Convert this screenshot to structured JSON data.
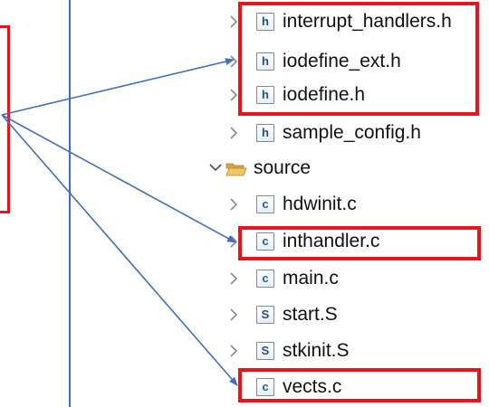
{
  "tree": {
    "items": [
      {
        "name": "interrupt_handlers.h",
        "type": "header",
        "badge": "h"
      },
      {
        "name": "iodefine_ext.h",
        "type": "header",
        "badge": "h"
      },
      {
        "name": "iodefine.h",
        "type": "header",
        "badge": "h"
      },
      {
        "name": "sample_config.h",
        "type": "header",
        "badge": "h"
      },
      {
        "name": "source",
        "type": "folder",
        "expanded": true
      },
      {
        "name": "hdwinit.c",
        "type": "c-source",
        "badge": "c"
      },
      {
        "name": "inthandler.c",
        "type": "c-source",
        "badge": "c"
      },
      {
        "name": "main.c",
        "type": "c-source",
        "badge": "c"
      },
      {
        "name": "start.S",
        "type": "asm-source",
        "badge": "S"
      },
      {
        "name": "stkinit.S",
        "type": "asm-source",
        "badge": "S"
      },
      {
        "name": "vects.c",
        "type": "c-source",
        "badge": "c"
      }
    ]
  },
  "highlighted_items": [
    "interrupt_handlers.h",
    "iodefine_ext.h",
    "iodefine.h",
    "inthandler.c",
    "vects.c"
  ],
  "colors": {
    "highlight": "#e8131b",
    "arrow": "#3f6fbd",
    "folder": "#e9b84a"
  }
}
